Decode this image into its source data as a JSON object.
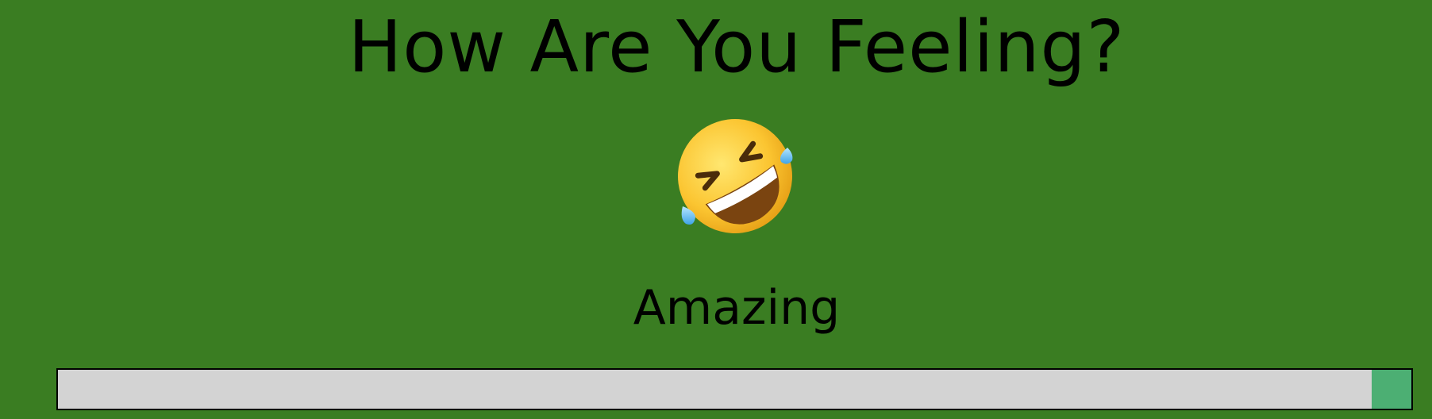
{
  "header": {
    "title": "How Are You Feeling?"
  },
  "mood": {
    "icon": "rolling-on-the-floor-laughing-emoji",
    "label": "Amazing"
  },
  "slider": {
    "value_fraction": 1.0,
    "track_color": "#d3d3d3",
    "thumb_color": "#4caf73"
  },
  "colors": {
    "background": "#3a7d22",
    "text": "#000000"
  }
}
